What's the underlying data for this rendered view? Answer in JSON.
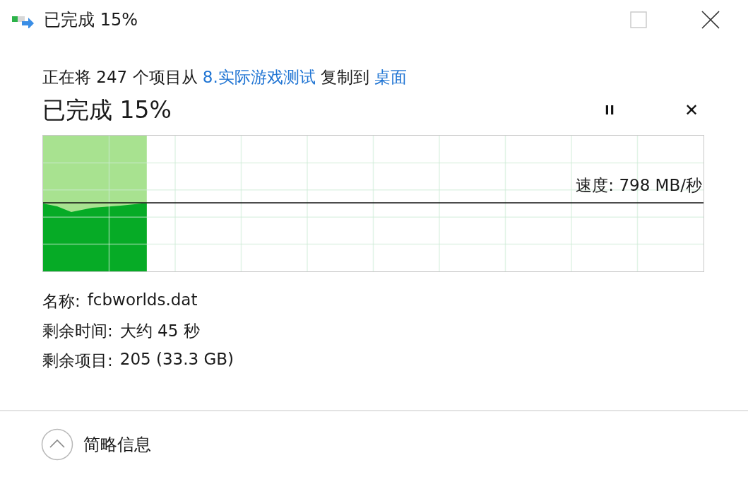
{
  "window": {
    "title": "已完成 15%"
  },
  "copy": {
    "prefix": "正在将 247 个项目从 ",
    "source": "8.实际游戏测试",
    "middle": " 复制到 ",
    "destination": "桌面"
  },
  "status": {
    "heading": "已完成 15%",
    "pause_label": "II",
    "cancel_label": "✕"
  },
  "graph": {
    "level": 0.157,
    "speed": "速度: 798 MB/秒"
  },
  "details": [
    {
      "label": "名称:",
      "value": "fcbworlds.dat"
    },
    {
      "label": "剩余时间:",
      "value": "大约 45 秒"
    },
    {
      "label": "剩余项目:",
      "value": "205 (33.3 GB)"
    }
  ],
  "footer": {
    "label": "简略信息"
  }
}
